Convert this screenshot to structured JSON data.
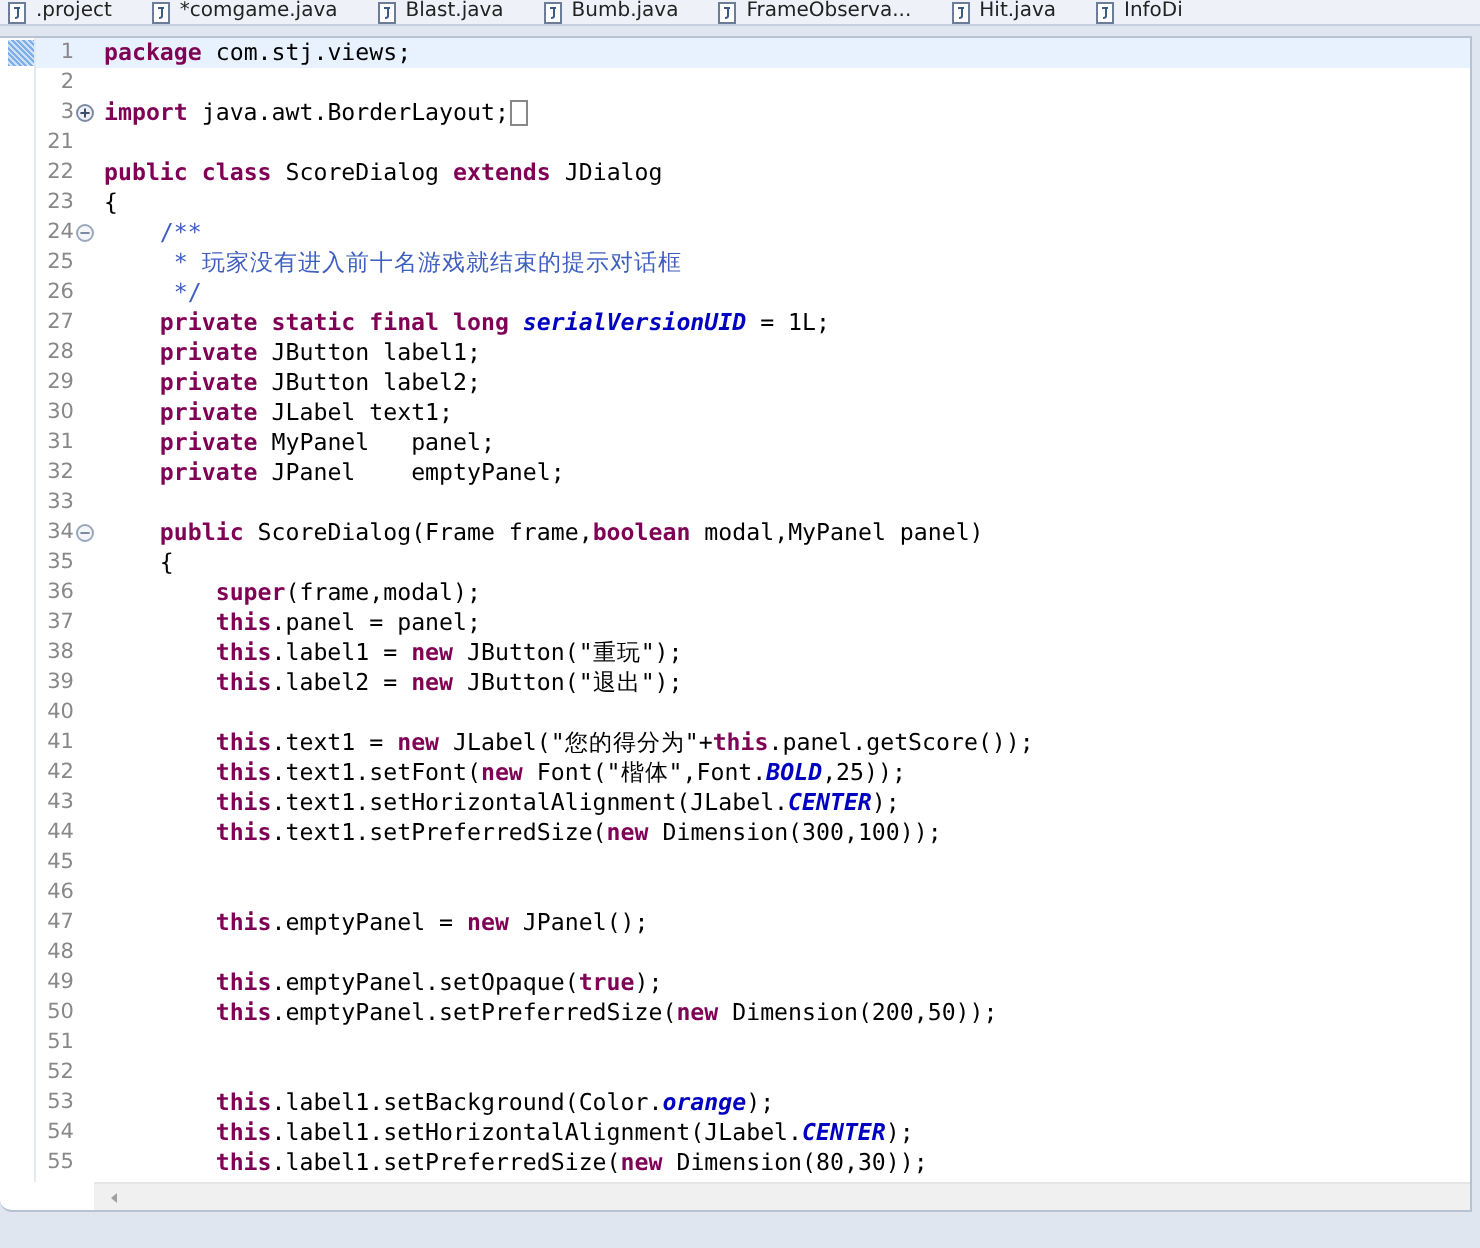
{
  "tabs": [
    {
      "label": ".project",
      "selected": false
    },
    {
      "label": "*comgame.java",
      "selected": false
    },
    {
      "label": "Blast.java",
      "selected": false
    },
    {
      "label": "Bumb.java",
      "selected": false
    },
    {
      "label": "FrameObserva...",
      "selected": false
    },
    {
      "label": "Hit.java",
      "selected": false
    },
    {
      "label": "InfoDi",
      "selected": false
    }
  ],
  "lines": [
    {
      "number": "1",
      "current": true,
      "kind": "code",
      "text": "**package** com.stj.views;"
    },
    {
      "number": "2",
      "current": false
    },
    {
      "number": "3",
      "current": false,
      "folded": true,
      "kind": "code",
      "text": "**import** java.awt.BorderLayout;"
    },
    {
      "number": "21",
      "current": false
    },
    {
      "number": "22",
      "current": false,
      "kind": "code",
      "text": "**public** **class** ScoreDialog **extends** JDialog"
    },
    {
      "number": "23",
      "current": false,
      "kind": "code",
      "text": "{"
    },
    {
      "number": "24",
      "current": false,
      "folded": false,
      "kind": "comment",
      "text": "    /**"
    },
    {
      "number": "25",
      "current": false,
      "kind": "comment",
      "text": "     * 玩家没有进入前十名游戏就结束的提示对话框"
    },
    {
      "number": "26",
      "current": false,
      "kind": "comment",
      "text": "     */"
    },
    {
      "number": "27",
      "current": false,
      "kind": "code",
      "text": "    **private static final long** *serialVersionUID* = 1L;"
    },
    {
      "number": "28",
      "current": false,
      "kind": "code",
      "text": "    **private** JButton label1;"
    },
    {
      "number": "29",
      "current": false,
      "kind": "code",
      "text": "    **private** JButton label2;"
    },
    {
      "number": "30",
      "current": false,
      "kind": "code",
      "text": "    **private** JLabel text1;"
    },
    {
      "number": "31",
      "current": false,
      "kind": "code",
      "text": "    **private** MyPanel   panel;"
    },
    {
      "number": "32",
      "current": false,
      "kind": "code",
      "text": "    **private** JPanel    emptyPanel;"
    },
    {
      "number": "33",
      "current": false
    },
    {
      "number": "34",
      "current": false,
      "folded": false,
      "kind": "code",
      "text": "    **public** ScoreDialog(Frame frame,**boolean** modal,MyPanel panel)"
    },
    {
      "number": "35",
      "current": false,
      "kind": "code",
      "text": "    {"
    },
    {
      "number": "36",
      "current": false,
      "kind": "code",
      "text": "        **super**(frame,modal);"
    },
    {
      "number": "37",
      "current": false,
      "kind": "code",
      "text": "        **this**.panel = panel;"
    },
    {
      "number": "38",
      "current": false,
      "kind": "code",
      "text": "        **this**.label1 = **new** JButton(\"重玩\");"
    },
    {
      "number": "39",
      "current": false,
      "kind": "code",
      "text": "        **this**.label2 = **new** JButton(\"退出\");"
    },
    {
      "number": "40",
      "current": false
    },
    {
      "number": "41",
      "current": false,
      "kind": "code",
      "text": "        **this**.text1 = **new** JLabel(\"您的得分为\"+**this**.panel.getScore());"
    },
    {
      "number": "42",
      "current": false,
      "kind": "code",
      "text": "        **this**.text1.setFont(**new** Font(\"楷体\",Font.*BOLD*,25));"
    },
    {
      "number": "43",
      "current": false,
      "kind": "code",
      "text": "        **this**.text1.setHorizontalAlignment(JLabel.*CENTER*);"
    },
    {
      "number": "44",
      "current": false,
      "kind": "code",
      "text": "        **this**.text1.setPreferredSize(**new** Dimension(300,100));"
    },
    {
      "number": "45",
      "current": false
    },
    {
      "number": "46",
      "current": false
    },
    {
      "number": "47",
      "current": false,
      "kind": "code",
      "text": "        **this**.emptyPanel = **new** JPanel();"
    },
    {
      "number": "48",
      "current": false
    },
    {
      "number": "49",
      "current": false,
      "kind": "code",
      "text": "        **this**.emptyPanel.setOpaque(**true**);"
    },
    {
      "number": "50",
      "current": false,
      "kind": "code",
      "text": "        **this**.emptyPanel.setPreferredSize(**new** Dimension(200,50));"
    },
    {
      "number": "51",
      "current": false
    },
    {
      "number": "52",
      "current": false
    },
    {
      "number": "53",
      "current": false,
      "kind": "code",
      "text": "        **this**.label1.setBackground(Color.*orange*);"
    },
    {
      "number": "54",
      "current": false,
      "kind": "code",
      "text": "        **this**.label1.setHorizontalAlignment(JLabel.*CENTER*);"
    },
    {
      "number": "55",
      "current": false,
      "kind": "code",
      "text": "        **this**.label1.setPreferredSize(**new** Dimension(80,30));"
    }
  ]
}
